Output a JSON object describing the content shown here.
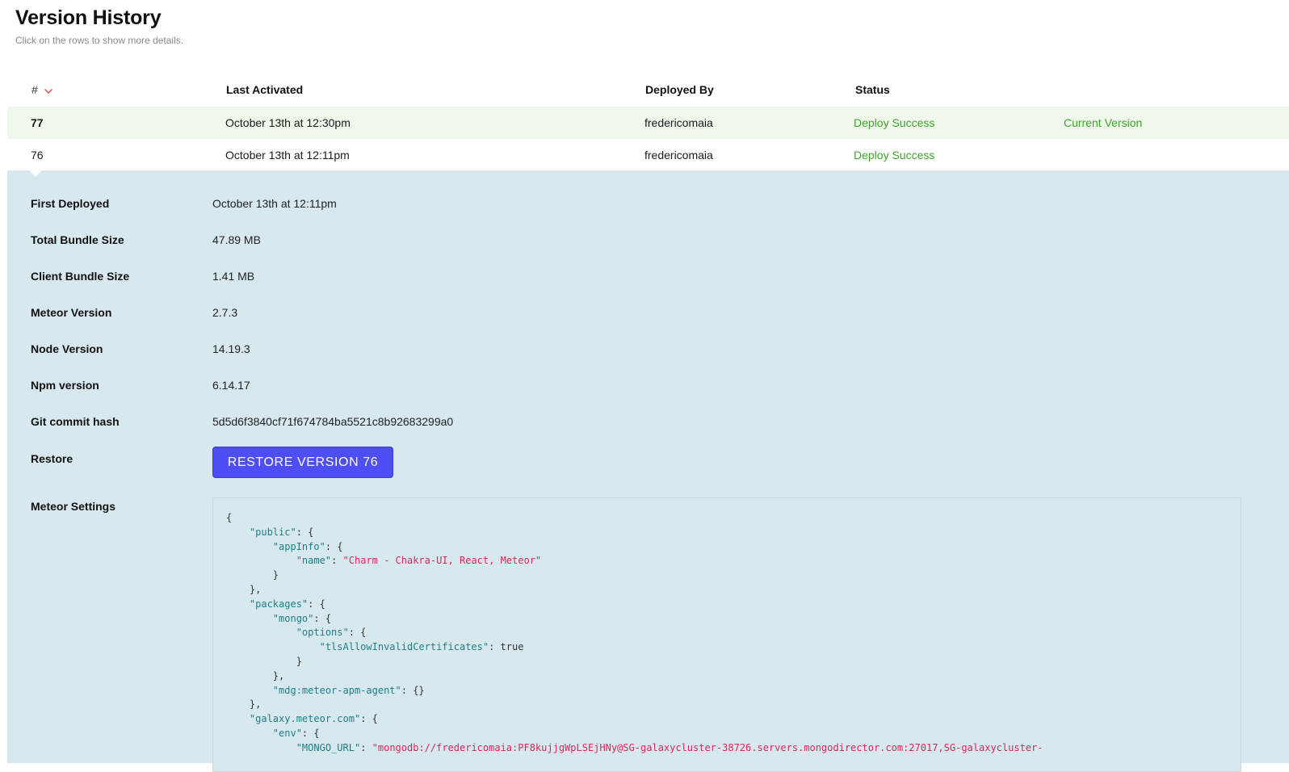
{
  "header": {
    "title": "Version History",
    "subtitle": "Click on the rows to show more details."
  },
  "table": {
    "columns": {
      "number": "#",
      "last_activated": "Last Activated",
      "deployed_by": "Deployed By",
      "status": "Status"
    },
    "sort_icon": "chevron-down-icon",
    "rows": [
      {
        "number": "77",
        "last_activated": "October 13th at 12:30pm",
        "deployed_by": "fredericomaia",
        "status": "Deploy Success",
        "badge": "Current Version"
      },
      {
        "number": "76",
        "last_activated": "October 13th at 12:11pm",
        "deployed_by": "fredericomaia",
        "status": "Deploy Success",
        "badge": ""
      }
    ]
  },
  "details": {
    "first_deployed": {
      "label": "First Deployed",
      "value": "October 13th at 12:11pm"
    },
    "total_bundle_size": {
      "label": "Total Bundle Size",
      "value": "47.89 MB"
    },
    "client_bundle_size": {
      "label": "Client Bundle Size",
      "value": "1.41 MB"
    },
    "meteor_version": {
      "label": "Meteor Version",
      "value": "2.7.3"
    },
    "node_version": {
      "label": "Node Version",
      "value": "14.19.3"
    },
    "npm_version": {
      "label": "Npm version",
      "value": "6.14.17"
    },
    "git_commit_hash": {
      "label": "Git commit hash",
      "value": "5d5d6f3840cf71f674784ba5521c8b92683299a0"
    },
    "restore": {
      "label": "Restore",
      "button_label": "RESTORE VERSION 76"
    },
    "meteor_settings": {
      "label": "Meteor Settings",
      "lines": [
        [
          {
            "t": "p",
            "v": "{"
          }
        ],
        [
          {
            "t": "p",
            "v": "    "
          },
          {
            "t": "k",
            "v": "\"public\""
          },
          {
            "t": "p",
            "v": ": {"
          }
        ],
        [
          {
            "t": "p",
            "v": "        "
          },
          {
            "t": "k",
            "v": "\"appInfo\""
          },
          {
            "t": "p",
            "v": ": {"
          }
        ],
        [
          {
            "t": "p",
            "v": "            "
          },
          {
            "t": "k",
            "v": "\"name\""
          },
          {
            "t": "p",
            "v": ": "
          },
          {
            "t": "s",
            "v": "\"Charm - Chakra-UI, React, Meteor\""
          }
        ],
        [
          {
            "t": "p",
            "v": "        }"
          }
        ],
        [
          {
            "t": "p",
            "v": "    },"
          }
        ],
        [
          {
            "t": "p",
            "v": "    "
          },
          {
            "t": "k",
            "v": "\"packages\""
          },
          {
            "t": "p",
            "v": ": {"
          }
        ],
        [
          {
            "t": "p",
            "v": "        "
          },
          {
            "t": "k",
            "v": "\"mongo\""
          },
          {
            "t": "p",
            "v": ": {"
          }
        ],
        [
          {
            "t": "p",
            "v": "            "
          },
          {
            "t": "k",
            "v": "\"options\""
          },
          {
            "t": "p",
            "v": ": {"
          }
        ],
        [
          {
            "t": "p",
            "v": "                "
          },
          {
            "t": "k",
            "v": "\"tlsAllowInvalidCertificates\""
          },
          {
            "t": "p",
            "v": ": true"
          }
        ],
        [
          {
            "t": "p",
            "v": "            }"
          }
        ],
        [
          {
            "t": "p",
            "v": "        },"
          }
        ],
        [
          {
            "t": "p",
            "v": "        "
          },
          {
            "t": "k",
            "v": "\"mdg:meteor-apm-agent\""
          },
          {
            "t": "p",
            "v": ": {}"
          }
        ],
        [
          {
            "t": "p",
            "v": "    },"
          }
        ],
        [
          {
            "t": "p",
            "v": "    "
          },
          {
            "t": "k",
            "v": "\"galaxy.meteor.com\""
          },
          {
            "t": "p",
            "v": ": {"
          }
        ],
        [
          {
            "t": "p",
            "v": "        "
          },
          {
            "t": "k",
            "v": "\"env\""
          },
          {
            "t": "p",
            "v": ": {"
          }
        ],
        [
          {
            "t": "p",
            "v": "            "
          },
          {
            "t": "k",
            "v": "\"MONGO_URL\""
          },
          {
            "t": "p",
            "v": ": "
          },
          {
            "t": "s",
            "v": "\"mongodb://fredericomaia:PF8kujjgWpLSEjHNy@SG-galaxycluster-38726.servers.mongodirector.com:27017,SG-galaxycluster-"
          }
        ]
      ]
    }
  },
  "colors": {
    "success": "#3fa42d",
    "current_row_bg": "#f0f8ec",
    "details_bg": "#d8e8ef",
    "button_bg": "#4e4ef6",
    "json_key": "#1d7f84",
    "json_string": "#d8275a",
    "sort_icon": "#e04a3a"
  }
}
